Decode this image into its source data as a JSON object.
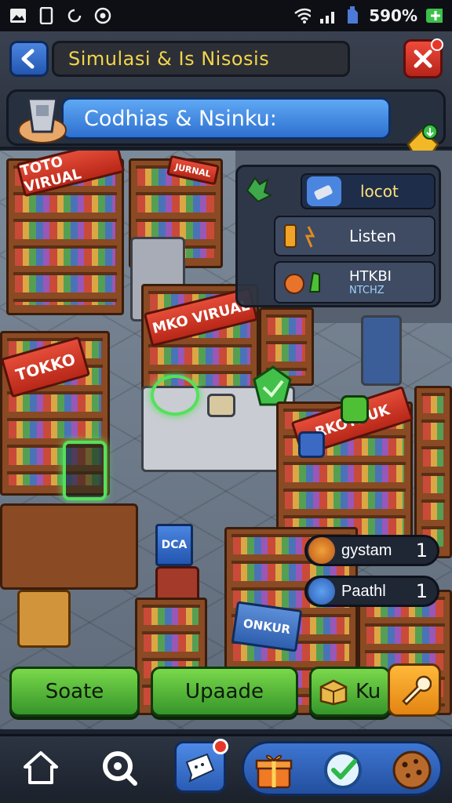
{
  "status_bar": {
    "icons_left": [
      "gallery-icon",
      "phone-icon",
      "sync-icon",
      "record-icon"
    ],
    "icons_right": [
      "wifi-icon",
      "signal-icon",
      "sim-icon",
      "battery-icon"
    ],
    "battery_text": "590%"
  },
  "header": {
    "title": "Simulasi & Is Nisosis",
    "player_name": "Codhias & Nsinku:"
  },
  "scene": {
    "signs": {
      "top_left": "TOTO VIRUAL",
      "top_center": "JURNAL",
      "left": "TOKKO",
      "center": "MKO VIRUAL",
      "right": "RKOYHUK",
      "tag": "DCA",
      "bottom": "ONKUR"
    }
  },
  "info_panel": {
    "rows": [
      {
        "label": "locot",
        "icon": "leaf-icon"
      },
      {
        "label": "Listen",
        "icon": "battery-item-icon"
      },
      {
        "label": "HTKBI",
        "sublabel": "NTCHZ",
        "icon": "fruit-icon"
      }
    ]
  },
  "resources": [
    {
      "label": "gystam",
      "value": "1",
      "icon": "gear-coin-icon"
    },
    {
      "label": "Paathl",
      "value": "1",
      "icon": "globe-coin-icon"
    }
  ],
  "actions": {
    "btn1": "Soate",
    "btn2": "Upaade",
    "btn3": "Ku"
  },
  "nav": {
    "items": [
      "home-icon",
      "search-icon",
      "chat-icon",
      "gift-icon",
      "check-icon",
      "cookie-icon"
    ]
  },
  "colors": {
    "title_text": "#f3d54a",
    "primary_blue": "#2d70cf",
    "action_green": "#4fbf36",
    "close_red": "#d9342a",
    "wrench_orange": "#f39a24"
  }
}
